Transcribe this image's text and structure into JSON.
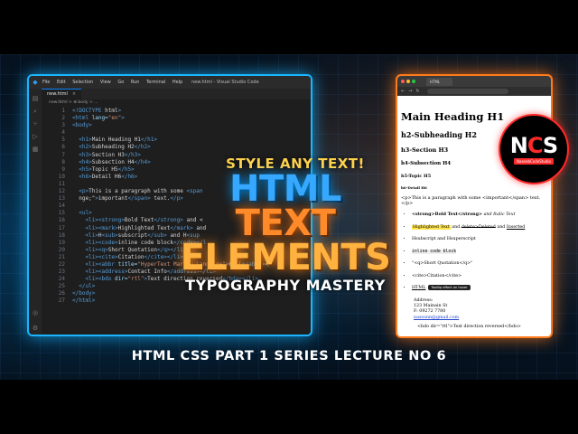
{
  "vscode": {
    "menu": [
      "File",
      "Edit",
      "Selection",
      "View",
      "Go",
      "Run",
      "Terminal",
      "Help"
    ],
    "window_title": "new.html - Visual Studio Code",
    "tab_label": "new.html",
    "breadcrumb": "new.html > ⊕ body > ...",
    "line_numbers": [
      "1",
      "2",
      "3",
      "4",
      "5",
      "6",
      "7",
      "8",
      "9",
      "10",
      "11",
      "12",
      "13",
      "14",
      "15",
      "16",
      "17",
      "18",
      "19",
      "20",
      "21",
      "22",
      "23",
      "24",
      "25",
      "26",
      "27"
    ],
    "code_lines": [
      "<!DOCTYPE html>",
      "<html lang=\"en\">",
      "<body>",
      "",
      "  <h1>Main Heading H1</h1>",
      "  <h2>Subheading H2</h2>",
      "  <h3>Section H3</h3>",
      "  <h4>Subsection H4</h4>",
      "  <h5>Topic H5</h5>",
      "  <h6>Detail H6</h6>",
      "",
      "  <p>This is a paragraph with some <span",
      "  nge;\">important</span> text.</p>",
      "",
      "  <ul>",
      "    <li><strong>Bold Text</strong> and <",
      "    <li><mark>Highlighted Text</mark> and",
      "    <li>H<sub>subscript</sub> and H<sup",
      "    <li><code>inline code block</code></l",
      "    <li><q>Short Quotation</q></li>",
      "    <li><cite>Citation</cite></li>",
      "    <li><abbr title=\"HyperText Markup Language\">HTML</abbr></",
      "    <li><address>Contact Info</address></li>",
      "    <li><bdo dir=\"rtl\">Text direction reversed</bdo></li>",
      "  </ul>",
      "</body>",
      "</html>"
    ]
  },
  "browser": {
    "tab_label": "HTML",
    "h1": "Main Heading H1",
    "h2": "h2-Subheading H2",
    "h3": "h3-Section H3",
    "h4": "h4-Subsection H4",
    "h5": "h5-Topic H5",
    "h6": "h6-Detail H6",
    "paragraph": "<p>This is a paragraph with some <important</span> text.</p>",
    "li1_a": "<strong>Bold Text</strong>",
    "li1_b": " and Italic Text",
    "li2_mark": "Highlighted Text",
    "li2_b": " and ",
    "li2_del": "delete>Deleted",
    "li2_c": " and ",
    "li2_ins": "Inserted",
    "li3": "Hsubscript and Hsuperscript",
    "li4": "inline code block",
    "li5": "\"<q>Short Quotation</q>\"",
    "li6": "<cite>Citation</cite>",
    "li7_abbr": "HTML",
    "li7_tooltip": "Tooltip effect on hover",
    "address": [
      "Address:",
      "123 Mainain St",
      "F: 09272 7780",
      "nassunn@gmail.com"
    ],
    "bdo": "<bdo dir=\"rtl\">Text direction reversed</bdo>"
  },
  "overlay": {
    "kicker": "STYLE ANY TEXT!",
    "title_line1_a": "HTML ",
    "title_line1_b": "TEXT",
    "title_line2": "ELEMENTS",
    "subtitle": "TYPOGRAPHY MASTERY"
  },
  "footer": "HTML CSS PART 1 SERIES LECTURE NO 6",
  "logo": {
    "mark_left": "N",
    "mark_mid": "C",
    "mark_right": "S",
    "tagline": "NaseebCodeStudio"
  },
  "colors": {
    "vscode_border": "#19b6ff",
    "browser_border": "#ff7a1a",
    "title_blue": "#36a8ff",
    "title_orange": "#ff8a2a",
    "kicker_yellow": "#ffd34d",
    "logo_red": "#ff2a2a"
  }
}
